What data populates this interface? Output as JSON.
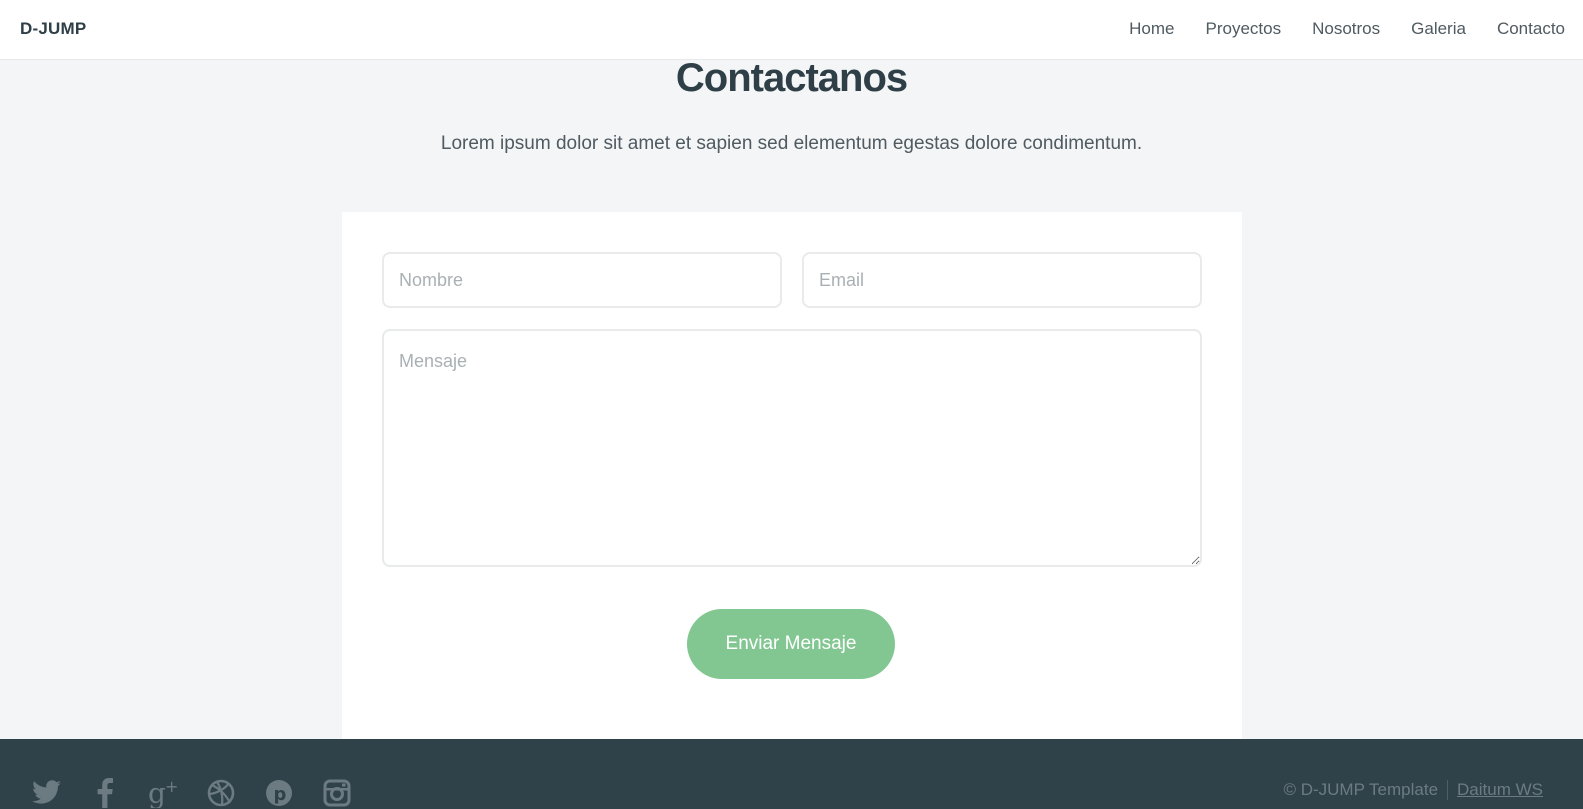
{
  "header": {
    "brand": "D-JUMP",
    "nav": [
      {
        "label": "Home"
      },
      {
        "label": "Proyectos"
      },
      {
        "label": "Nosotros"
      },
      {
        "label": "Galeria"
      },
      {
        "label": "Contacto"
      }
    ]
  },
  "section": {
    "title": "Contactanos",
    "subtitle": "Lorem ipsum dolor sit amet et sapien sed elementum egestas dolore condimentum."
  },
  "form": {
    "name_placeholder": "Nombre",
    "name_value": "",
    "email_placeholder": "Email",
    "email_value": "",
    "message_placeholder": "Mensaje",
    "message_value": "",
    "submit_label": "Enviar Mensaje",
    "submit_color": "#82c792"
  },
  "footer": {
    "socials": [
      "twitter-icon",
      "facebook-icon",
      "google-plus-icon",
      "dribbble-icon",
      "pinterest-icon",
      "instagram-icon"
    ],
    "copyright": "© D-JUMP Template",
    "credit": "Daitum WS",
    "background": "#2f424a"
  }
}
